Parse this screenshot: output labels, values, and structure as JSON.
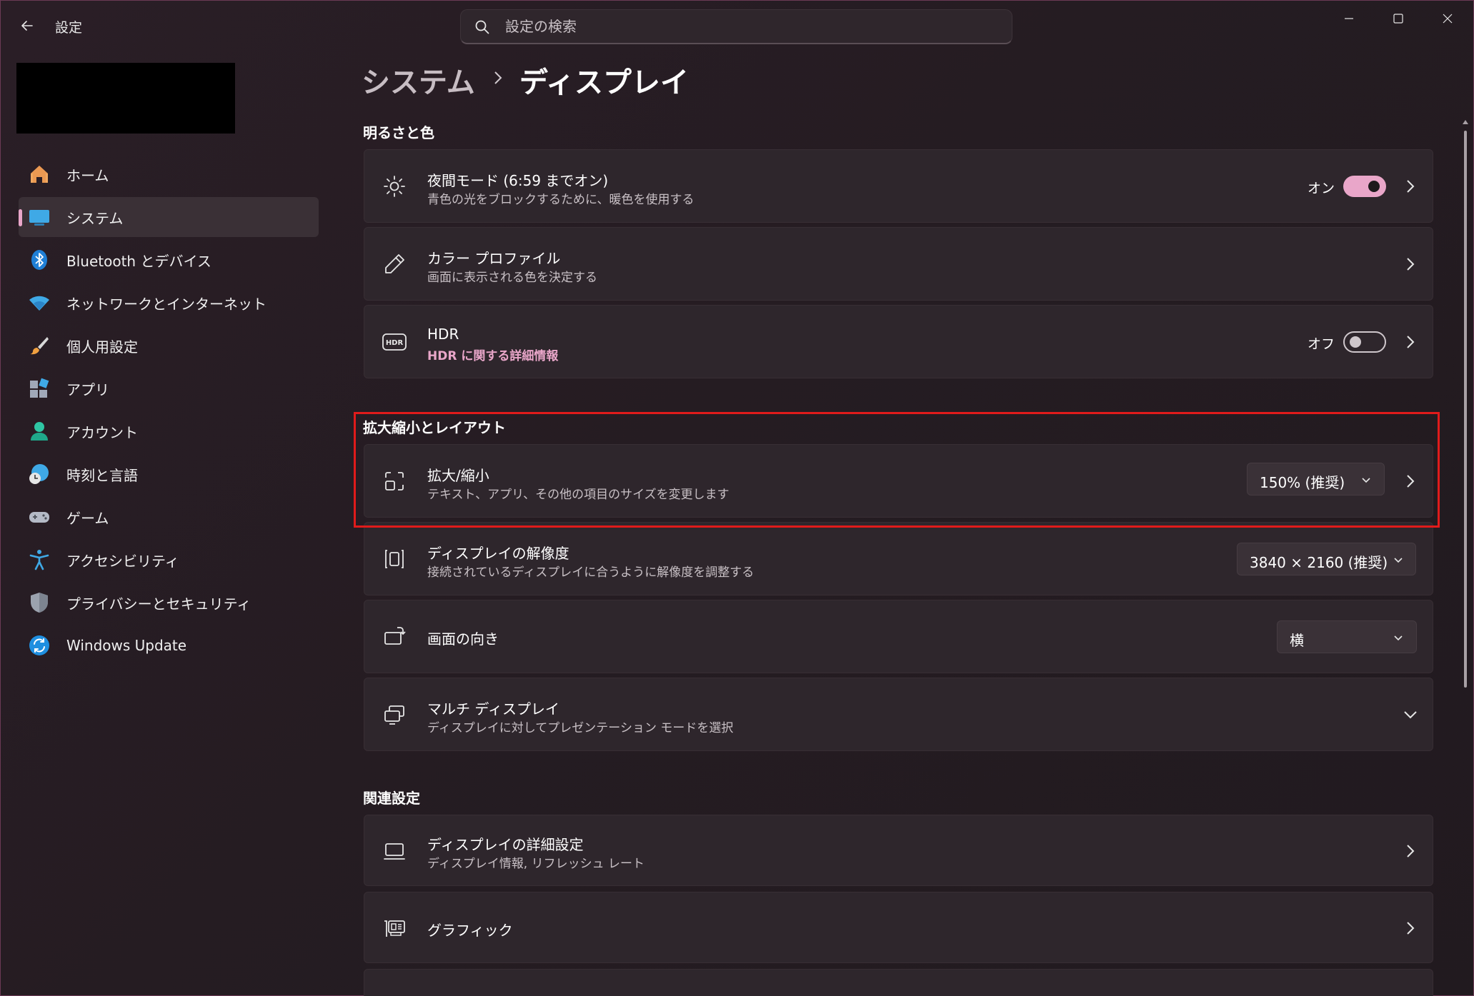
{
  "window": {
    "app_title": "設定",
    "search_placeholder": "設定の検索"
  },
  "sidebar": {
    "items": [
      {
        "label": "ホーム",
        "icon": "home-icon",
        "selected": false
      },
      {
        "label": "システム",
        "icon": "system-icon",
        "selected": true
      },
      {
        "label": "Bluetooth とデバイス",
        "icon": "bluetooth-icon",
        "selected": false
      },
      {
        "label": "ネットワークとインターネット",
        "icon": "wifi-icon",
        "selected": false
      },
      {
        "label": "個人用設定",
        "icon": "brush-icon",
        "selected": false
      },
      {
        "label": "アプリ",
        "icon": "apps-icon",
        "selected": false
      },
      {
        "label": "アカウント",
        "icon": "account-icon",
        "selected": false
      },
      {
        "label": "時刻と言語",
        "icon": "globe-clock-icon",
        "selected": false
      },
      {
        "label": "ゲーム",
        "icon": "gamepad-icon",
        "selected": false
      },
      {
        "label": "アクセシビリティ",
        "icon": "accessibility-icon",
        "selected": false
      },
      {
        "label": "プライバシーとセキュリティ",
        "icon": "shield-icon",
        "selected": false
      },
      {
        "label": "Windows Update",
        "icon": "update-icon",
        "selected": false
      }
    ]
  },
  "breadcrumb": {
    "parent": "システム",
    "current": "ディスプレイ"
  },
  "sections": {
    "brightness": {
      "title": "明るさと色",
      "night_light": {
        "title": "夜間モード (6:59 までオン)",
        "subtitle": "青色の光をブロックするために、暖色を使用する",
        "state": "オン",
        "on": true
      },
      "color_profile": {
        "title": "カラー プロファイル",
        "subtitle": "画面に表示される色を決定する"
      },
      "hdr": {
        "title": "HDR",
        "link": "HDR に関する詳細情報",
        "state": "オフ",
        "on": false
      }
    },
    "scale_layout": {
      "title": "拡大縮小とレイアウト",
      "scale": {
        "title": "拡大/縮小",
        "subtitle": "テキスト、アプリ、その他の項目のサイズを変更します",
        "value": "150% (推奨)"
      },
      "resolution": {
        "title": "ディスプレイの解像度",
        "subtitle": "接続されているディスプレイに合うように解像度を調整する",
        "value": "3840 × 2160 (推奨)"
      },
      "orientation": {
        "title": "画面の向き",
        "value": "横"
      },
      "multi_display": {
        "title": "マルチ ディスプレイ",
        "subtitle": "ディスプレイに対してプレゼンテーション モードを選択"
      }
    },
    "related": {
      "title": "関連設定",
      "advanced_display": {
        "title": "ディスプレイの詳細設定",
        "subtitle": "ディスプレイ情報, リフレッシュ レート"
      },
      "graphics": {
        "title": "グラフィック"
      }
    }
  },
  "colors": {
    "accent": "#e9a6c9",
    "highlight": "#e01b1b",
    "card": "#2e262c"
  }
}
